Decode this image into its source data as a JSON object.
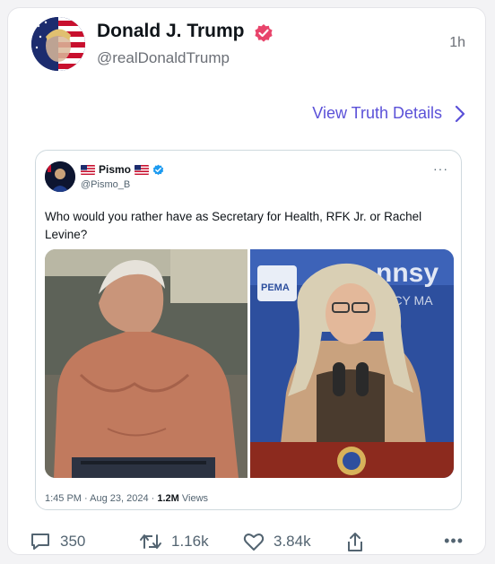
{
  "post": {
    "author_name": "Donald J. Trump",
    "author_handle": "@realDonaldTrump",
    "time_ago": "1h",
    "view_details": "View Truth Details"
  },
  "quoted": {
    "author_name": "Pismo",
    "author_handle": "@Pismo_B",
    "more": "···",
    "text": "Who would you rather have as Secretary for Health, RFK Jr. or Rachel Levine?",
    "time": "1:45 PM · Aug 23, 2024 · ",
    "views_count": "1.2M",
    "views_label": " Views",
    "image_text": {
      "sign_big": "nnsy",
      "sign_small": "ENCY MA",
      "sign_logo": "PEMA"
    }
  },
  "actions": {
    "replies": "350",
    "retruths": "1.16k",
    "likes": "3.84k",
    "more": "•••"
  },
  "colors": {
    "accent": "#5b51d8",
    "verified": "#e8446b",
    "twitter_blue": "#1d9bf0"
  }
}
